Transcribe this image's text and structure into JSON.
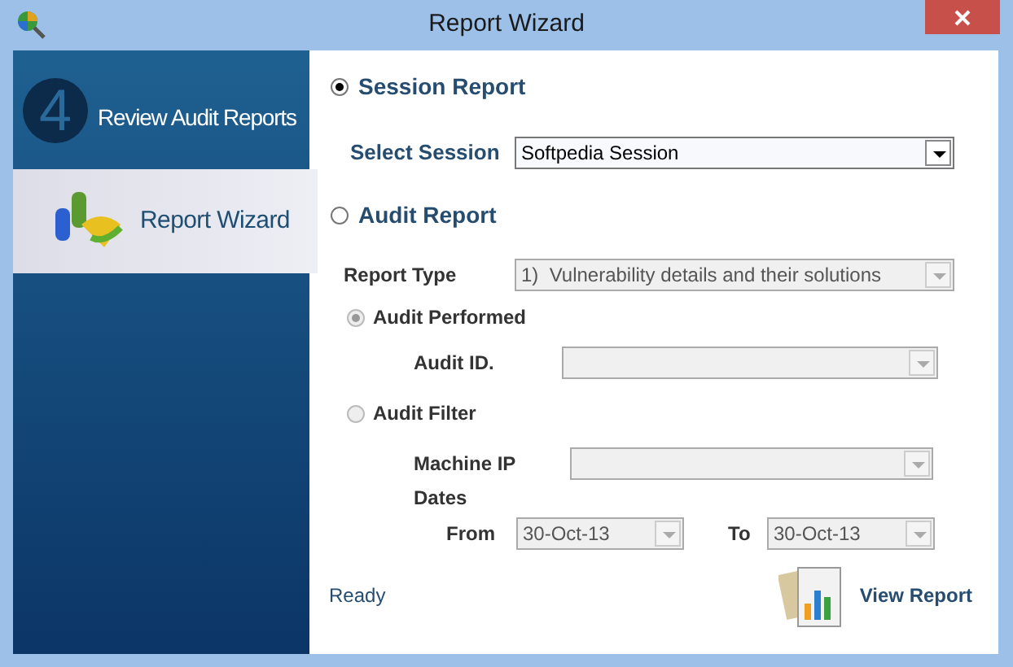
{
  "window": {
    "title": "Report Wizard"
  },
  "sidebar": {
    "items": [
      {
        "label": "Review Audit Reports",
        "selected": false,
        "number": "4"
      },
      {
        "label": "Report Wizard",
        "selected": true
      }
    ]
  },
  "session_report": {
    "label": "Session Report",
    "selected": true
  },
  "select_session": {
    "label": "Select Session",
    "value": "Softpedia Session",
    "disabled": false
  },
  "audit_report": {
    "label": "Audit Report",
    "selected": false
  },
  "report_type": {
    "label": "Report Type",
    "value": "1)  Vulnerability details and their solutions",
    "disabled": true
  },
  "audit_performed": {
    "label": "Audit Performed",
    "selected": true,
    "disabled": true
  },
  "audit_id": {
    "label": "Audit ID.",
    "disabled": true
  },
  "audit_filter": {
    "label": "Audit Filter",
    "selected": false,
    "disabled": true
  },
  "machine_ip": {
    "label": "Machine IP",
    "disabled": true
  },
  "dates_label": "Dates",
  "from": {
    "label": "From",
    "value": "30-Oct-13",
    "disabled": true
  },
  "to": {
    "label": "To",
    "value": "30-Oct-13",
    "disabled": true
  },
  "status_bar": {
    "text": "Ready"
  },
  "view_report_button": {
    "label": "View Report"
  }
}
